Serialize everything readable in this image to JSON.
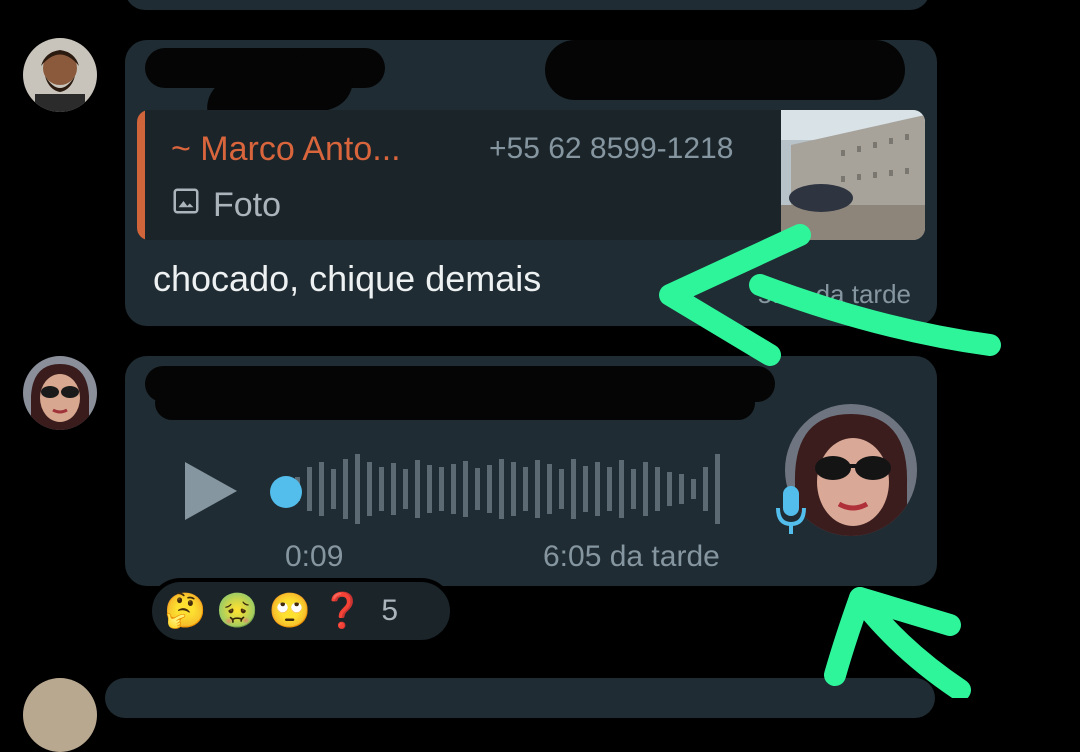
{
  "colors": {
    "background": "#000000",
    "bubble": "#1f2c33",
    "quote_author": "#d8653c",
    "secondary_text": "#8696a0",
    "accent_blue": "#53bdeb",
    "annotation_green": "#2ef59a"
  },
  "message1": {
    "quoted": {
      "author": "~ Marco Anto...",
      "phone": "+55 62 8599-1218",
      "type_icon": "image-icon",
      "type_label": "Foto"
    },
    "text": "chocado, chique demais",
    "time": "5:5_ da tarde"
  },
  "message2": {
    "duration": "0:09",
    "time": "6:05 da tarde",
    "mic_icon": "microphone-icon",
    "play_icon": "play-icon"
  },
  "reactions": {
    "emojis": [
      "🤔",
      "🤢",
      "🙄",
      "❓"
    ],
    "count": "5"
  }
}
